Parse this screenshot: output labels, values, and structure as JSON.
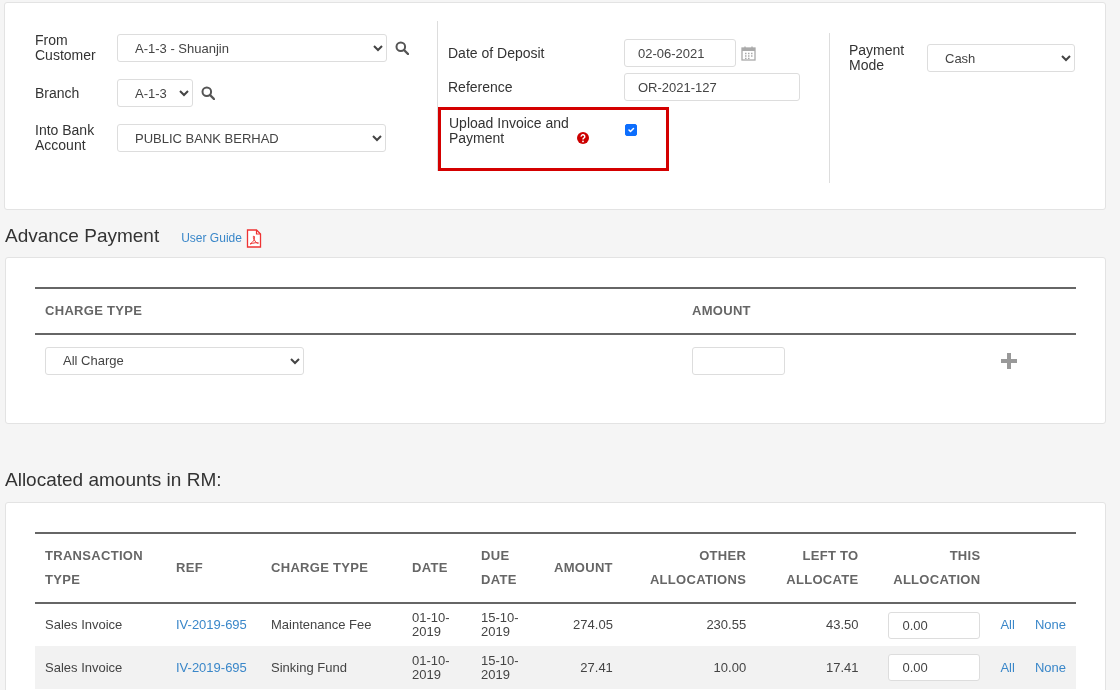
{
  "deposit_form": {
    "customer": {
      "label": "From Customer",
      "value": "A-1-3 - Shuanjin"
    },
    "branch": {
      "label": "Branch",
      "value": "A-1-3"
    },
    "bank_account": {
      "label": "Into Bank Account",
      "value": "PUBLIC BANK BERHAD"
    },
    "date_of_deposit": {
      "label": "Date of Deposit",
      "value": "02-06-2021"
    },
    "reference": {
      "label": "Reference",
      "value": "OR-2021-127"
    },
    "upload_invoice": {
      "label": "Upload Invoice and Payment",
      "checked": true,
      "highlighted": true
    },
    "payment_mode": {
      "label": "Payment Mode",
      "value": "Cash"
    }
  },
  "advance_payment": {
    "title": "Advance Payment",
    "guide_link": "User Guide",
    "columns": [
      "CHARGE TYPE",
      "AMOUNT"
    ],
    "row": {
      "charge_type": "All Charge"
    }
  },
  "allocations": {
    "title": "Allocated amounts in RM:",
    "columns": [
      "TRANSACTION TYPE",
      "REF",
      "CHARGE TYPE",
      "DATE",
      "DUE DATE",
      "AMOUNT",
      "OTHER ALLOCATIONS",
      "LEFT TO ALLOCATE",
      "THIS ALLOCATION"
    ],
    "rows": [
      {
        "transaction_type": "Sales Invoice",
        "ref": "IV-2019-695",
        "charge_type": "Maintenance Fee",
        "date": "01-10-2019",
        "due_date": "15-10-2019",
        "amount": "274.05",
        "other_allocations": "230.55",
        "left_to_allocate": "43.50",
        "this_allocation": "0.00",
        "all_link": "All",
        "none_link": "None"
      },
      {
        "transaction_type": "Sales Invoice",
        "ref": "IV-2019-695",
        "charge_type": "Sinking Fund",
        "date": "01-10-2019",
        "due_date": "15-10-2019",
        "amount": "27.41",
        "other_allocations": "10.00",
        "left_to_allocate": "17.41",
        "this_allocation": "0.00",
        "all_link": "All",
        "none_link": "None"
      }
    ]
  }
}
